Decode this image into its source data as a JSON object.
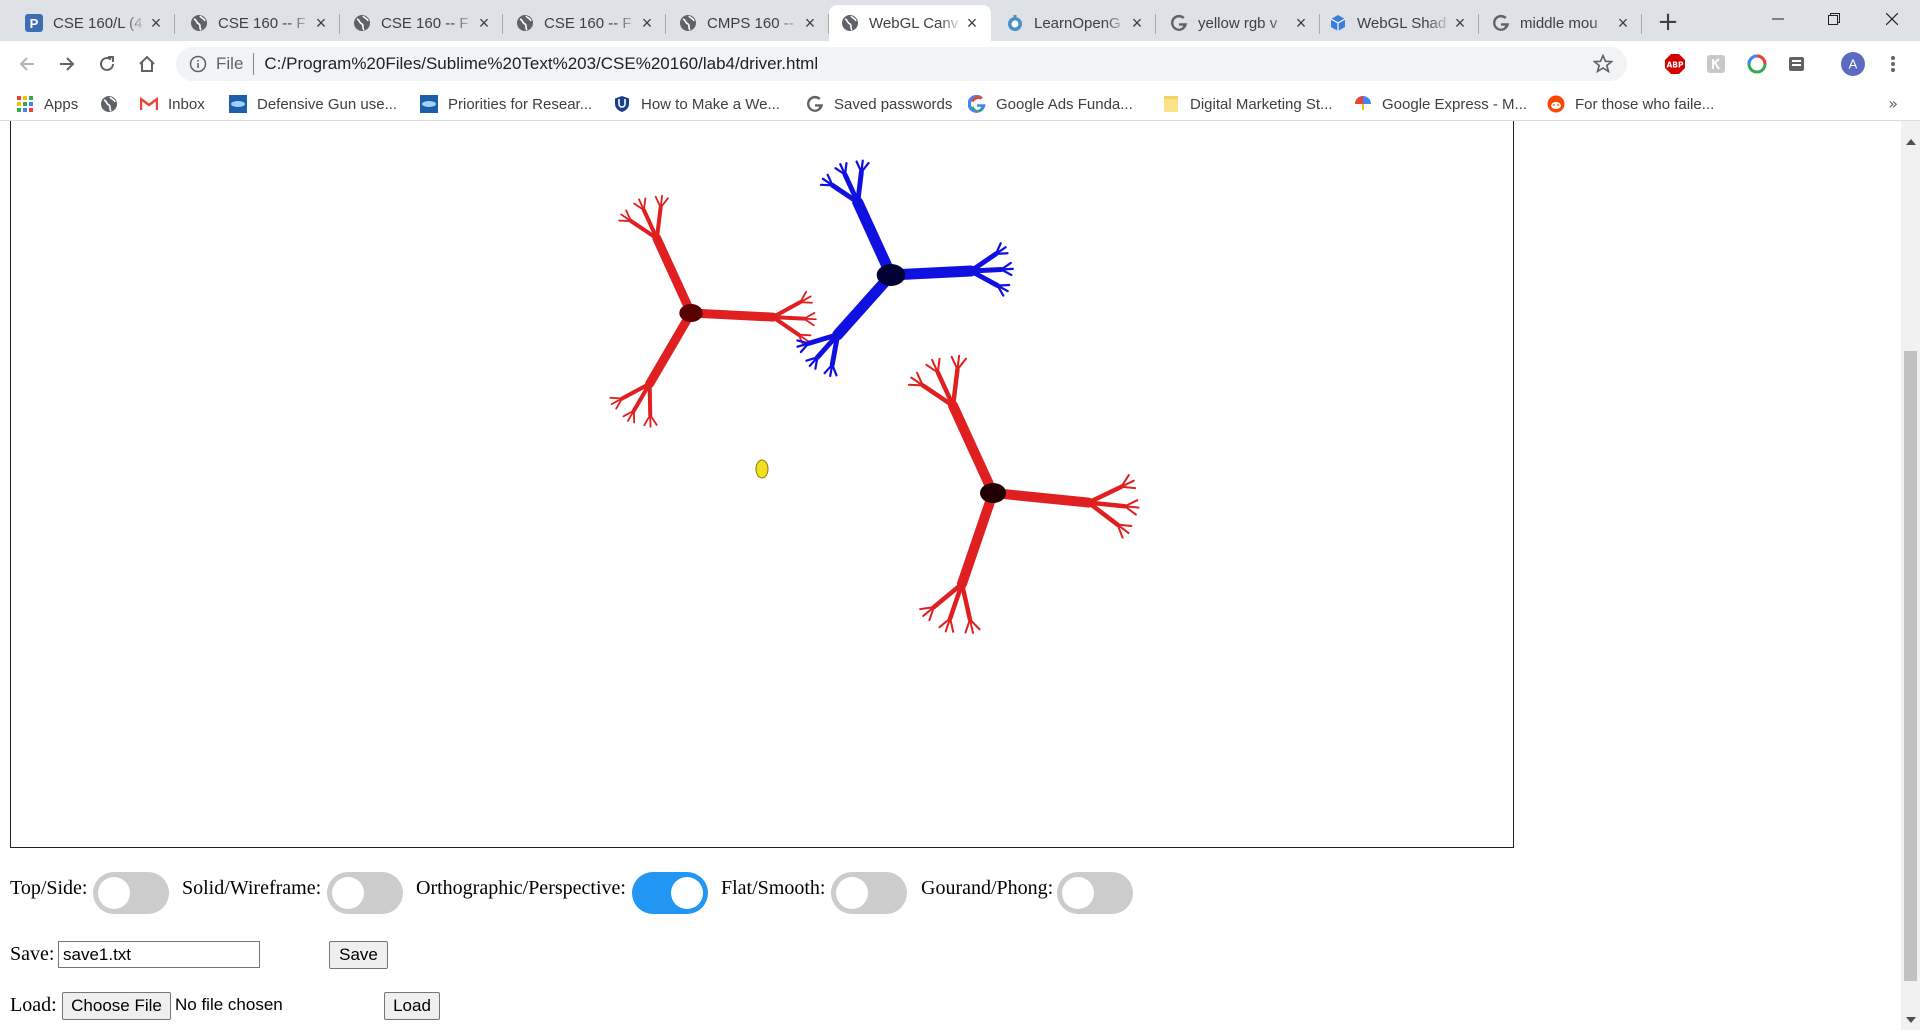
{
  "browser": {
    "tabs": [
      {
        "title": "CSE 160/L (4",
        "favicon": "p-letter-icon",
        "active": false
      },
      {
        "title": "CSE 160 -- F",
        "favicon": "globe-icon",
        "active": false
      },
      {
        "title": "CSE 160 -- F",
        "favicon": "globe-icon",
        "active": false
      },
      {
        "title": "CSE 160 -- F",
        "favicon": "globe-icon",
        "active": false
      },
      {
        "title": "CMPS 160 --",
        "favicon": "globe-icon",
        "active": false
      },
      {
        "title": "WebGL Canv",
        "favicon": "globe-icon",
        "active": true
      },
      {
        "title": "LearnOpenG",
        "favicon": "learnopengl-icon",
        "active": false
      },
      {
        "title": "yellow rgb v",
        "favicon": "google-g-icon",
        "active": false
      },
      {
        "title": "WebGL Shad",
        "favicon": "cube-icon",
        "active": false
      },
      {
        "title": "middle mou",
        "favicon": "google-g-icon",
        "active": false
      }
    ],
    "address": {
      "scheme_label": "File",
      "url": "C:/Program%20Files/Sublime%20Text%203/CSE%20160/lab4/driver.html"
    },
    "profile_initial": "A",
    "bookmarks": [
      {
        "label": "Apps",
        "icon": "apps-grid-icon"
      },
      {
        "label": "",
        "icon": "globe-icon"
      },
      {
        "label": "Inbox",
        "icon": "gmail-icon"
      },
      {
        "label": "Defensive Gun use...",
        "icon": "site-icon"
      },
      {
        "label": "Priorities for Resear...",
        "icon": "site-icon"
      },
      {
        "label": "How to Make a We...",
        "icon": "shield-icon"
      },
      {
        "label": "Saved passwords",
        "icon": "google-g-icon"
      },
      {
        "label": "Google Ads Funda...",
        "icon": "google-color-icon"
      },
      {
        "label": "Digital Marketing St...",
        "icon": "folder-icon"
      },
      {
        "label": "Google Express - M...",
        "icon": "umbrella-icon"
      },
      {
        "label": "For those who faile...",
        "icon": "reddit-icon"
      }
    ],
    "bookmarks_more": "»"
  },
  "page": {
    "toggles": [
      {
        "label": "Top/Side:",
        "on": false
      },
      {
        "label": "Solid/Wireframe:",
        "on": false
      },
      {
        "label": "Orthographic/Perspective:",
        "on": true
      },
      {
        "label": "Flat/Smooth:",
        "on": false
      },
      {
        "label": "Gourand/Phong:",
        "on": false
      }
    ],
    "save": {
      "label": "Save:",
      "filename": "save1.txt",
      "button": "Save"
    },
    "load": {
      "label": "Load:",
      "choose_button": "Choose File",
      "file_status": "No file chosen",
      "button": "Load"
    },
    "scene_colors": {
      "tree_red": "#e02020",
      "tree_blue": "#1010e0",
      "light": "#f0e020"
    }
  }
}
